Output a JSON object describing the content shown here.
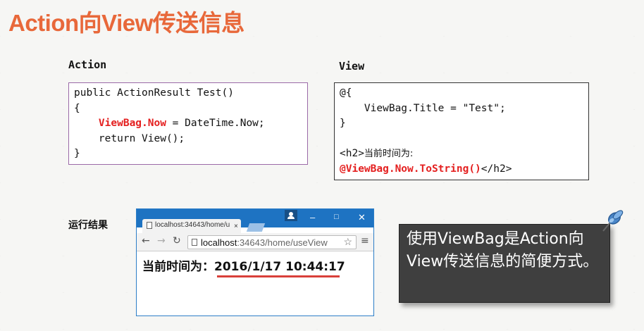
{
  "slide": {
    "title": "Action向View传送信息"
  },
  "action": {
    "label": "Action",
    "code": {
      "line1": "public ActionResult Test()",
      "line2": "{",
      "line3_indent": "    ",
      "line3_highlight": "ViewBag.Now",
      "line3_rest": " = DateTime.Now;",
      "line4": "    return View();",
      "line5": "}"
    }
  },
  "view": {
    "label": "View",
    "code": {
      "line1": "@{",
      "line2": "    ViewBag.Title = \"Test\";",
      "line3": "}",
      "line5_tag": "<h2>",
      "line5_text": "当前时间为:",
      "line6_highlight": "@ViewBag.Now.ToString()",
      "line6_rest": "</h2>"
    }
  },
  "result": {
    "label": "运行结果"
  },
  "browser": {
    "tab_title": "localhost:34643/home/u",
    "tab_close": "×",
    "window_controls": {
      "minimize": "–",
      "maximize": "□",
      "close": "✕"
    },
    "nav": {
      "back": "←",
      "forward": "→",
      "reload": "↻"
    },
    "url_host": "localhost",
    "url_rest": ":34643/home/useView",
    "star": "☆",
    "menu": "≡",
    "page_label": "当前时间为：",
    "page_value": "2016/1/17 10:44:17",
    "accent_color": "#1e73c2"
  },
  "note": {
    "text": "使用ViewBag是Action向View传送信息的简便方式。"
  },
  "colors": {
    "title": "#e8683a",
    "highlight": "#e42020",
    "underline": "#d9403a"
  },
  "icons": [
    "push-pin-icon",
    "user-icon",
    "document-icon",
    "star-icon",
    "menu-icon"
  ]
}
